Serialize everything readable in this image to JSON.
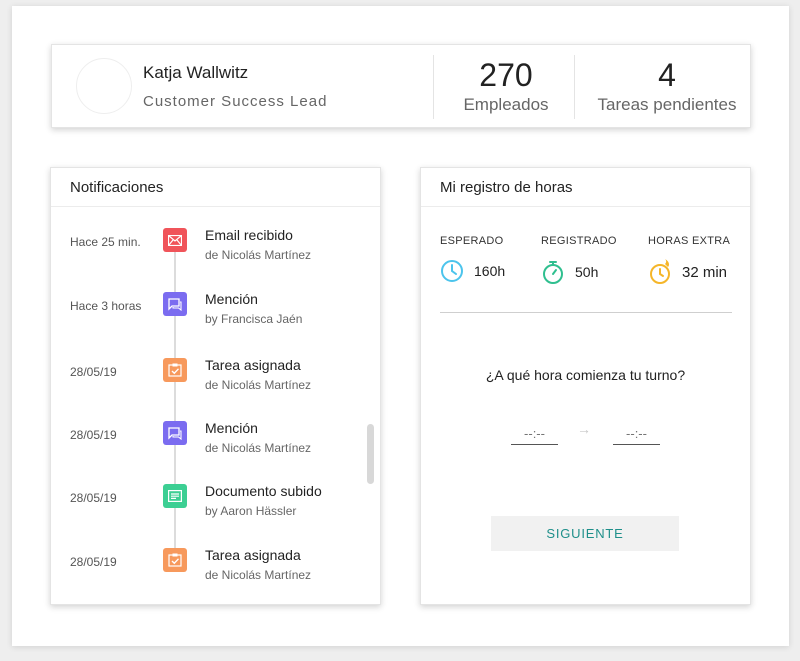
{
  "profile": {
    "name": "Katja Wallwitz",
    "role": "Customer Success Lead",
    "stats": [
      {
        "value": "270",
        "label": "Empleados"
      },
      {
        "value": "4",
        "label": "Tareas pendientes"
      }
    ]
  },
  "notifications": {
    "title": "Notificaciones",
    "items": [
      {
        "time": "Hace 25 min.",
        "title": "Email recibido",
        "sub": "de Nicolás Martínez",
        "icon": "mail-icon",
        "color": "#f0545a"
      },
      {
        "time": "Hace 3 horas",
        "title": "Mención",
        "sub": "by Francisca Jaén",
        "icon": "chat-icon",
        "color": "#7b6cf0"
      },
      {
        "time": "28/05/19",
        "title": "Tarea asignada",
        "sub": "de Nicolás Martínez",
        "icon": "clipboard-check-icon",
        "color": "#f7995c"
      },
      {
        "time": "28/05/19",
        "title": "Mención",
        "sub": "de Nicolás Martínez",
        "icon": "chat-icon",
        "color": "#7b6cf0"
      },
      {
        "time": "28/05/19",
        "title": "Documento subido",
        "sub": "by Aaron Hässler",
        "icon": "document-icon",
        "color": "#3ccf93"
      },
      {
        "time": "28/05/19",
        "title": "Tarea asignada",
        "sub": "de Nicolás Martínez",
        "icon": "clipboard-check-icon",
        "color": "#f7995c"
      }
    ]
  },
  "hours": {
    "title": "Mi registro de horas",
    "stats": [
      {
        "label": "ESPERADO",
        "value": "160h",
        "icon": "clock-icon",
        "color": "#4cc4ec"
      },
      {
        "label": "REGISTRADO",
        "value": "50h",
        "icon": "stopwatch-icon",
        "color": "#2fbf8f"
      },
      {
        "label": "HORAS EXTRA",
        "value": "32 min",
        "icon": "clock-fire-icon",
        "color": "#f5b62a"
      }
    ],
    "question": "¿A qué hora comienza tu turno?",
    "start_placeholder": "--:--",
    "end_placeholder": "--:--",
    "arrow": "→",
    "next_label": "SIGUIENTE"
  }
}
